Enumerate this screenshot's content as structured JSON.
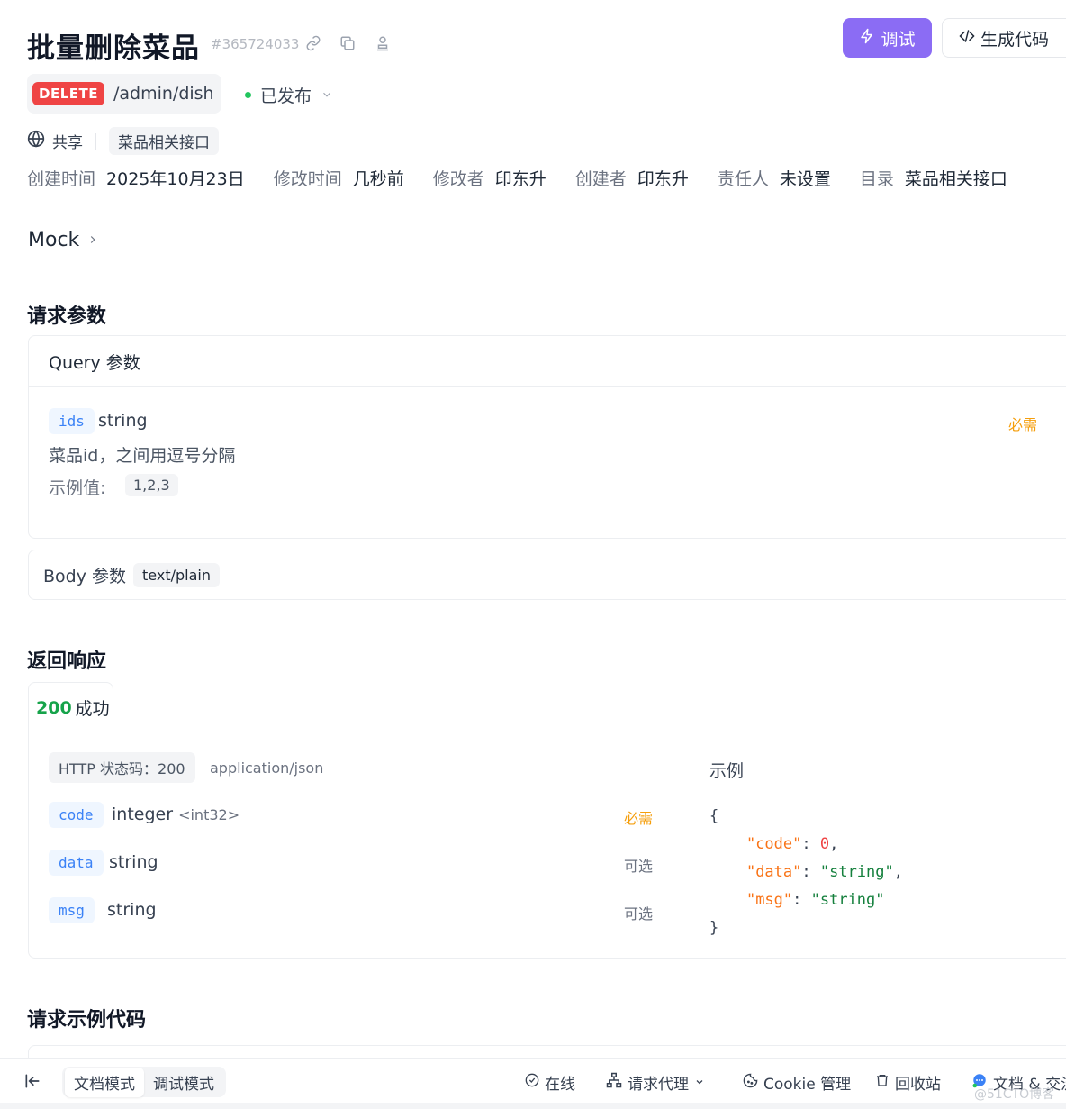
{
  "header": {
    "title": "批量删除菜品",
    "api_id": "#365724033",
    "debug_label": "调试",
    "gen_code_label": "生成代码"
  },
  "endpoint": {
    "method": "DELETE",
    "path": "/admin/dish",
    "status": "已发布"
  },
  "share": {
    "label": "共享",
    "folder_tag": "菜品相关接口"
  },
  "meta": {
    "created_label": "创建时间",
    "created_value": "2025年10月23日",
    "modified_label": "修改时间",
    "modified_value": "几秒前",
    "modifier_label": "修改者",
    "modifier_value": "印东升",
    "creator_label": "创建者",
    "creator_value": "印东升",
    "owner_label": "责任人",
    "owner_value": "未设置",
    "dir_label": "目录",
    "dir_value": "菜品相关接口"
  },
  "mock": {
    "label": "Mock"
  },
  "request": {
    "section_title": "请求参数",
    "query_title": "Query 参数",
    "query_params": [
      {
        "name": "ids",
        "type": "string",
        "required": "必需",
        "description": "菜品id，之间用逗号分隔",
        "example_label": "示例值:",
        "example_value": "1,2,3"
      }
    ],
    "body_title": "Body 参数",
    "body_content_type": "text/plain"
  },
  "response": {
    "section_title": "返回响应",
    "tab_code": "200",
    "tab_label": "成功",
    "http_status": "HTTP 状态码：200",
    "content_type": "application/json",
    "fields": [
      {
        "name": "code",
        "type": "integer",
        "format": "<int32>",
        "flag": "必需"
      },
      {
        "name": "data",
        "type": "string",
        "format": "",
        "flag": "可选"
      },
      {
        "name": "msg",
        "type": "string",
        "format": "",
        "flag": "可选"
      }
    ],
    "example_title": "示例",
    "example": {
      "open": "{",
      "close": "}",
      "code_key": "\"code\"",
      "code_val": "0",
      "data_key": "\"data\"",
      "data_val": "\"string\"",
      "msg_key": "\"msg\"",
      "msg_val": "\"string\""
    }
  },
  "code_section": {
    "title": "请求示例代码"
  },
  "bottom_bar": {
    "doc_mode": "文档模式",
    "debug_mode": "调试模式",
    "online": "在线",
    "proxy": "请求代理",
    "cookie": "Cookie 管理",
    "trash": "回收站",
    "docs": "文档 & 交流"
  },
  "watermark": "@51CTO博客",
  "colors": {
    "accent": "#8b6cf4",
    "delete": "#ef4444",
    "success": "#16a34a",
    "required": "#f59e0b",
    "param": "#3b82f6"
  }
}
